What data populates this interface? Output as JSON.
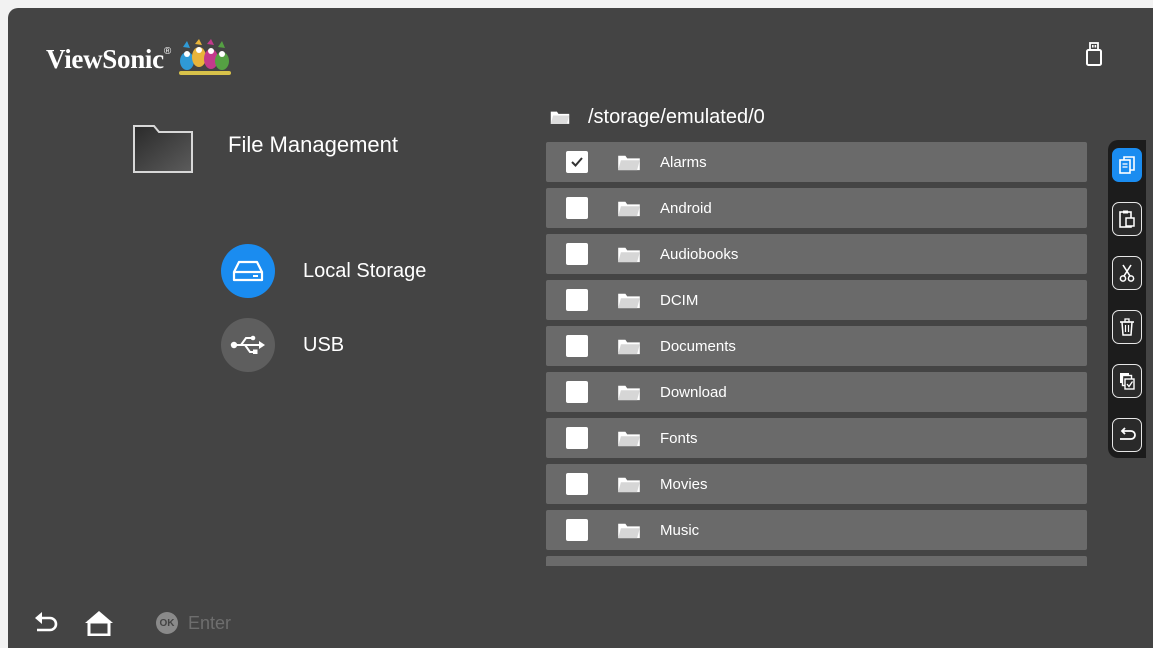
{
  "header": {
    "logo_text": "ViewSonic",
    "logo_mark": "®",
    "usb_indicator_icon": "usb-stick-icon"
  },
  "main": {
    "title": "File Management",
    "sources": [
      {
        "label": "Local Storage",
        "icon": "hard-drive-icon",
        "selected": true
      },
      {
        "label": "USB",
        "icon": "usb-icon",
        "selected": false
      }
    ]
  },
  "browser": {
    "path": "/storage/emulated/0",
    "items": [
      {
        "name": "Alarms",
        "checked": true
      },
      {
        "name": "Android",
        "checked": false
      },
      {
        "name": "Audiobooks",
        "checked": false
      },
      {
        "name": "DCIM",
        "checked": false
      },
      {
        "name": "Documents",
        "checked": false
      },
      {
        "name": "Download",
        "checked": false
      },
      {
        "name": "Fonts",
        "checked": false
      },
      {
        "name": "Movies",
        "checked": false
      },
      {
        "name": "Music",
        "checked": false
      }
    ]
  },
  "actions": [
    {
      "name": "copy",
      "icon": "copy-icon",
      "active": true
    },
    {
      "name": "paste",
      "icon": "paste-icon",
      "active": false
    },
    {
      "name": "cut",
      "icon": "cut-icon",
      "active": false
    },
    {
      "name": "delete",
      "icon": "trash-icon",
      "active": false
    },
    {
      "name": "select-all",
      "icon": "select-all-icon",
      "active": false
    },
    {
      "name": "back",
      "icon": "return-icon",
      "active": false
    }
  ],
  "footer": {
    "ok_badge": "OK",
    "enter_label": "Enter"
  },
  "colors": {
    "background": "#444444",
    "row": "#6a6a6a",
    "accent": "#1a8cf0",
    "action_bar": "#1c1c1c"
  }
}
